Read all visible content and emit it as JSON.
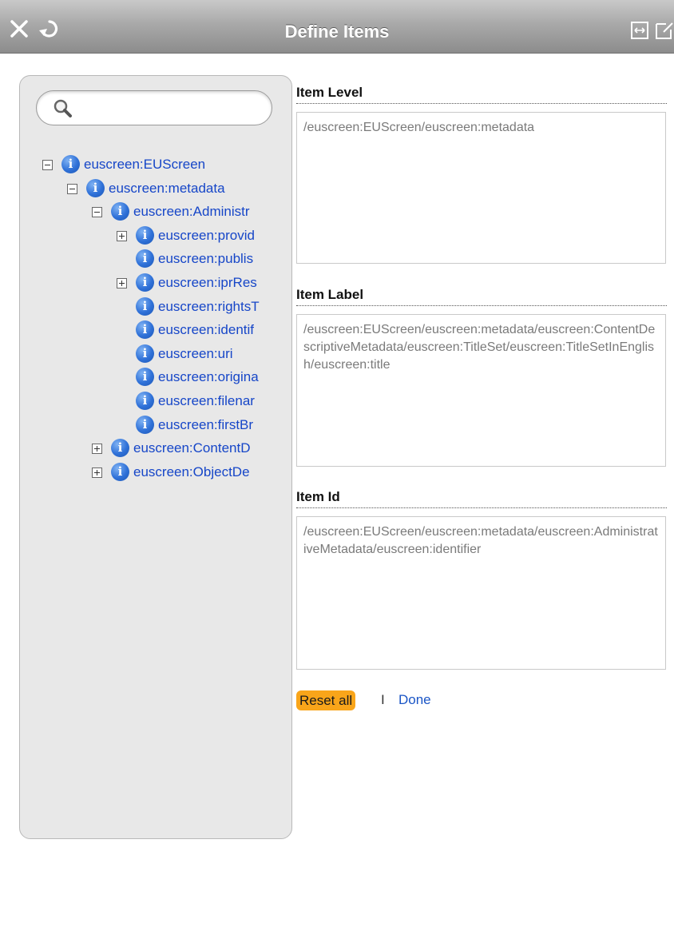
{
  "titlebar": {
    "title": "Define Items",
    "icons": [
      "close-icon",
      "refresh-icon",
      "expand-icon",
      "popout-icon"
    ]
  },
  "search": {
    "value": "",
    "placeholder": ""
  },
  "tree": [
    {
      "label": "euscreen:EUScreen",
      "toggle": "minus",
      "level": 0
    },
    {
      "label": "euscreen:metadata",
      "toggle": "minus",
      "level": 1
    },
    {
      "label": "euscreen:Administr",
      "toggle": "minus",
      "level": 2
    },
    {
      "label": "euscreen:provid",
      "toggle": "plus",
      "level": 3
    },
    {
      "label": "euscreen:publis",
      "toggle": "none",
      "level": 3
    },
    {
      "label": "euscreen:iprRes",
      "toggle": "plus",
      "level": 3
    },
    {
      "label": "euscreen:rightsT",
      "toggle": "none",
      "level": 3
    },
    {
      "label": "euscreen:identif",
      "toggle": "none",
      "level": 3
    },
    {
      "label": "euscreen:uri",
      "toggle": "none",
      "level": 3
    },
    {
      "label": "euscreen:origina",
      "toggle": "none",
      "level": 3
    },
    {
      "label": "euscreen:filenar",
      "toggle": "none",
      "level": 3
    },
    {
      "label": "euscreen:firstBr",
      "toggle": "none",
      "level": 3
    },
    {
      "label": "euscreen:ContentD",
      "toggle": "plus",
      "level": 2
    },
    {
      "label": "euscreen:ObjectDe",
      "toggle": "plus",
      "level": 2
    }
  ],
  "item_level": {
    "label": "Item Level",
    "value": "/euscreen:EUScreen/euscreen:metadata"
  },
  "item_label": {
    "label": "Item Label",
    "value": "/euscreen:EUScreen/euscreen:metadata/euscreen:ContentDescriptiveMetadata/euscreen:TitleSet/euscreen:TitleSetInEnglish/euscreen:title"
  },
  "item_id": {
    "label": "Item Id",
    "value": "/euscreen:EUScreen/euscreen:metadata/euscreen:AdministrativeMetadata/euscreen:identifier"
  },
  "actions": {
    "reset_label": "Reset all",
    "separator": "I",
    "done_label": "Done",
    "reset_color": "#f9a51a"
  },
  "colors": {
    "link": "#1646c8",
    "info_icon": "#2f71d8"
  }
}
